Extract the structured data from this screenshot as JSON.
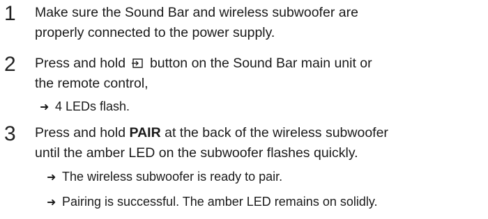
{
  "steps": [
    {
      "number": "1",
      "lines": [
        "Make sure the Sound Bar and wireless subwoofer are",
        "properly connected to the power supply."
      ]
    },
    {
      "number": "2",
      "line1_before": "Press and hold",
      "line1_icon": "source-input-icon",
      "line1_after": "button on the Sound Bar main unit or",
      "line2": "the remote control,",
      "results": [
        "4 LEDs flash."
      ]
    },
    {
      "number": "3",
      "line1_before": "Press and hold",
      "line1_bold": "PAIR",
      "line1_after": "at the back of the wireless subwoofer",
      "line2": "until the amber LED on the subwoofer flashes quickly.",
      "results": [
        "The wireless subwoofer is ready to pair.",
        "Pairing is successful. The amber LED remains on solidly."
      ]
    }
  ],
  "result_arrow": "➜"
}
